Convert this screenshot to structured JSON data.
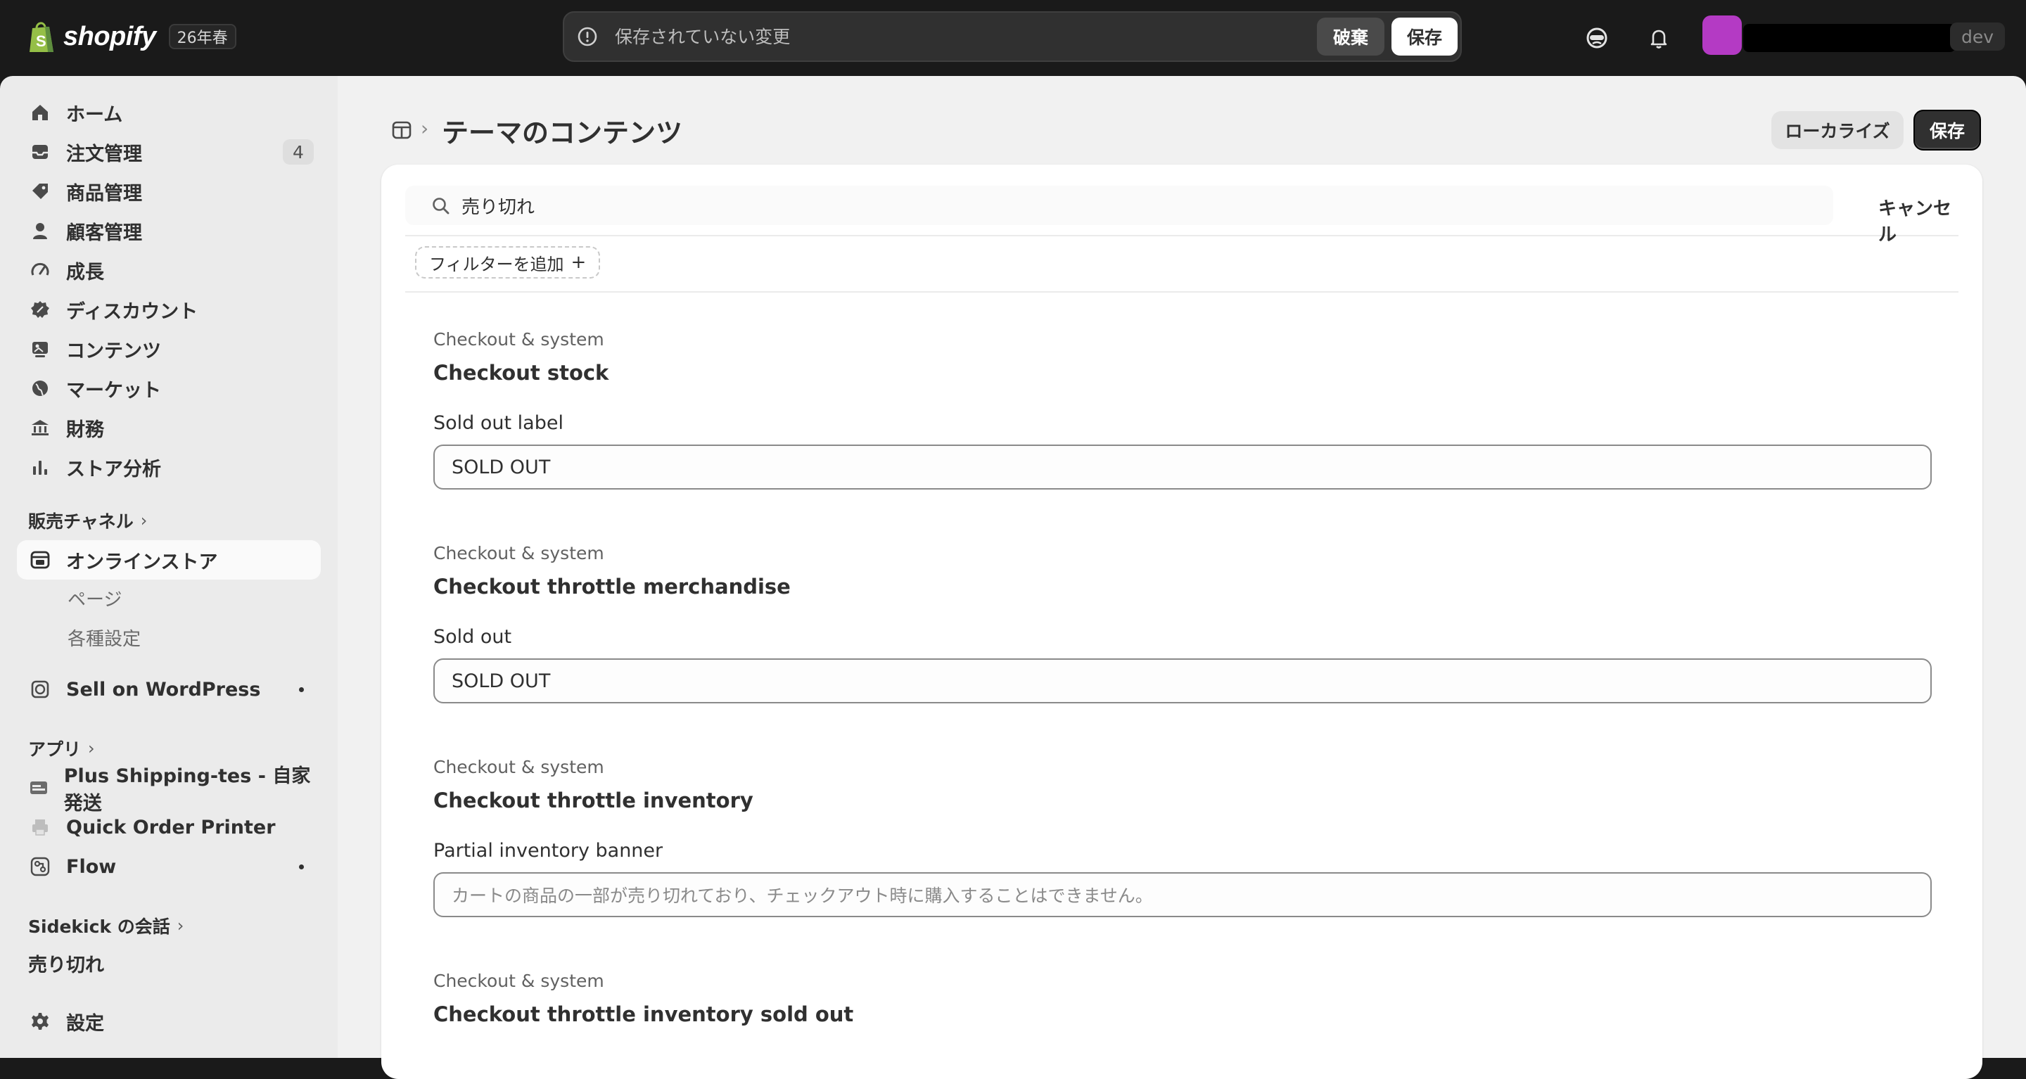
{
  "topbar": {
    "logo_text": "shopify",
    "version_badge": "26年春",
    "unsaved_text": "保存されていない変更",
    "discard_label": "破棄",
    "save_label": "保存",
    "dev_badge": "dev"
  },
  "sidebar": {
    "items": [
      {
        "label": "ホーム",
        "icon": "home-icon"
      },
      {
        "label": "注文管理",
        "icon": "inbox-icon",
        "badge": "4"
      },
      {
        "label": "商品管理",
        "icon": "tag-icon"
      },
      {
        "label": "顧客管理",
        "icon": "person-icon"
      },
      {
        "label": "成長",
        "icon": "gauge-icon"
      },
      {
        "label": "ディスカウント",
        "icon": "discount-icon"
      },
      {
        "label": "コンテンツ",
        "icon": "content-icon"
      },
      {
        "label": "マーケット",
        "icon": "globe-icon"
      },
      {
        "label": "財務",
        "icon": "bank-icon"
      },
      {
        "label": "ストア分析",
        "icon": "bar-chart-icon"
      }
    ],
    "sales_channels_label": "販売チャネル",
    "online_store_label": "オンラインストア",
    "online_store_subitems": [
      "ページ",
      "各種設定"
    ],
    "sell_on_wordpress_label": "Sell on WordPress",
    "apps_label": "アプリ",
    "apps": [
      {
        "label": "Plus Shipping-tes - 自家発送",
        "icon": "shipping-app-icon"
      },
      {
        "label": "Quick Order Printer",
        "icon": "printer-app-icon"
      },
      {
        "label": "Flow",
        "icon": "flow-app-icon"
      }
    ],
    "sidekick_label": "Sidekick の会話",
    "sidekick_item": "売り切れ",
    "settings_label": "設定"
  },
  "main": {
    "title": "テーマのコンテンツ",
    "localize_label": "ローカライズ",
    "save_label": "保存",
    "search_value": "売り切れ",
    "cancel_label": "キャンセル",
    "add_filter_label": "フィルターを追加",
    "groups": [
      {
        "category": "Checkout & system",
        "title": "Checkout stock",
        "field_label": "Sold out label",
        "value": "SOLD OUT",
        "placeholder": ""
      },
      {
        "category": "Checkout & system",
        "title": "Checkout throttle merchandise",
        "field_label": "Sold out",
        "value": "SOLD OUT",
        "placeholder": ""
      },
      {
        "category": "Checkout & system",
        "title": "Checkout throttle inventory",
        "field_label": "Partial inventory banner",
        "value": "",
        "placeholder": "カートの商品の一部が売り切れており、チェックアウト時に購入することはできません。"
      },
      {
        "category": "Checkout & system",
        "title": "Checkout throttle inventory sold out"
      }
    ]
  },
  "colors": {
    "topbar_bg": "#1a1a1a",
    "sidebar_bg": "#ebebeb",
    "main_bg": "#f1f1f1",
    "avatar": "#b43ac4",
    "primary_button": "#303030"
  }
}
